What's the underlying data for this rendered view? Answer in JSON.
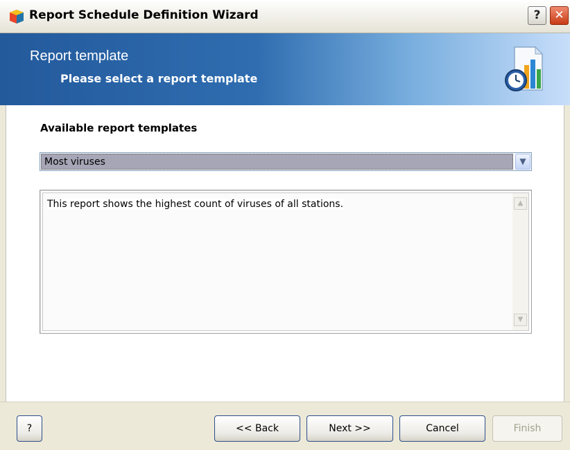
{
  "window": {
    "title": "Report Schedule Definition Wizard",
    "help_label": "?",
    "close_label": "✕"
  },
  "header": {
    "title": "Report template",
    "subtitle": "Please select a report template",
    "icon": "report-schedule-icon"
  },
  "main": {
    "section_label": "Available report templates",
    "template_select": {
      "value": "Most viruses"
    },
    "description": "This report shows the highest count of viruses of all stations."
  },
  "footer": {
    "help_label": "?",
    "back_label": "<< Back",
    "next_label": "Next >>",
    "cancel_label": "Cancel",
    "finish_label": "Finish"
  },
  "colors": {
    "banner_start": "#235a9c",
    "banner_end": "#c8defa",
    "selection": "#a6a6b6"
  }
}
